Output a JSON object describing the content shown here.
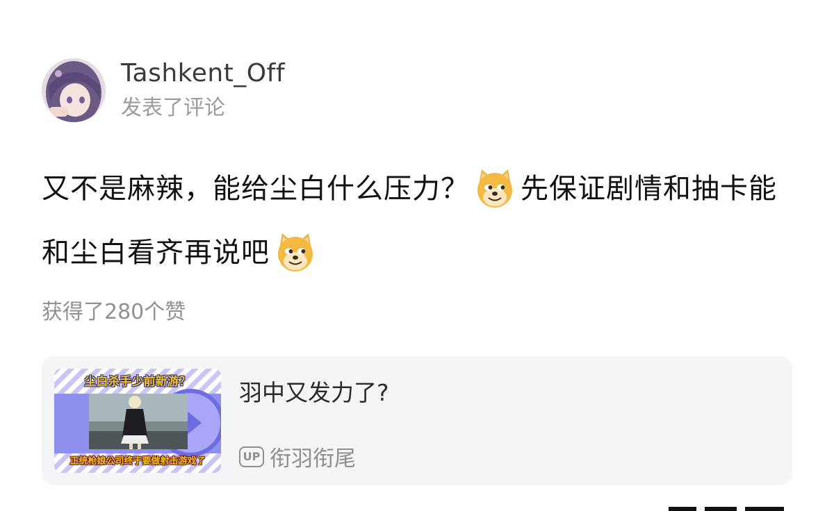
{
  "post": {
    "username": "Tashkent_Off",
    "action": "发表了评论",
    "comment_part1": "又不是麻辣，能给尘白什么压力？",
    "comment_part2": "先保证剧情和抽卡能和尘白看齐再说吧",
    "emoji_icon": "doge-emoji",
    "likes": "获得了280个赞"
  },
  "video_card": {
    "title": "羽中又发力了?",
    "up_badge": "UP",
    "uploader": "衔羽衔尾",
    "thumb_top_text": "尘白杀手少前新游？",
    "thumb_bottom_text": "正统枪娘公司终于要做射击游戏了"
  },
  "colors": {
    "background": "#ffffff",
    "card_bg": "#f4f5f7",
    "secondary_text": "#8e8e93",
    "thumb_purple": "#8f8ff0",
    "thumb_caption": "#f2c21b"
  }
}
